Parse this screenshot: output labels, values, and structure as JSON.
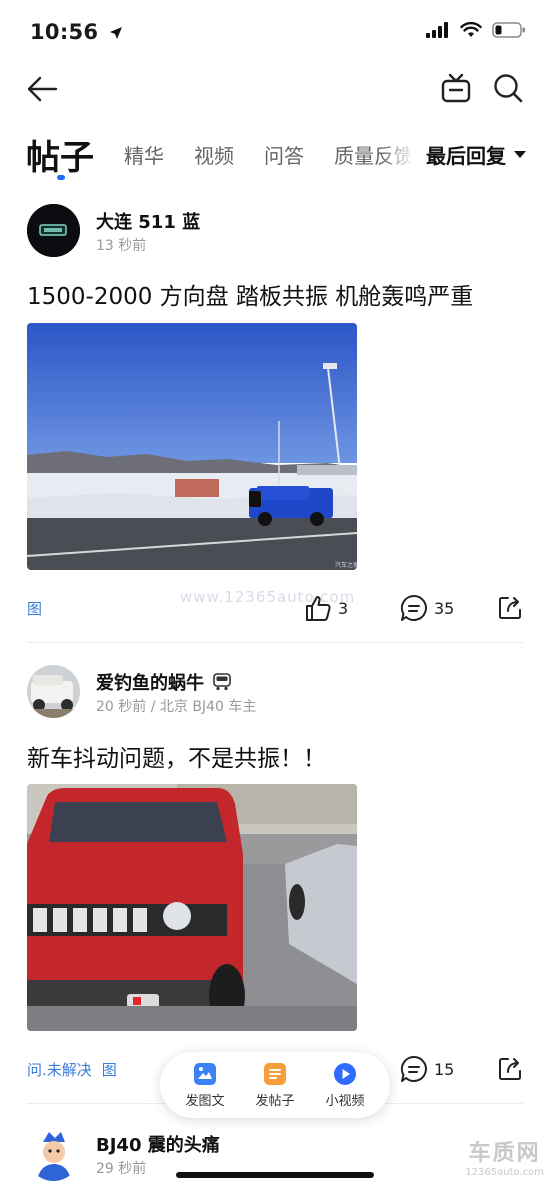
{
  "status_bar": {
    "time": "10:56"
  },
  "tabs": [
    {
      "label": "帖子",
      "active": true
    },
    {
      "label": "精华"
    },
    {
      "label": "视频"
    },
    {
      "label": "问答"
    },
    {
      "label": "质量反馈"
    }
  ],
  "sort": {
    "label": "最后回复"
  },
  "posts": [
    {
      "author": "大连 511 蓝",
      "meta": "13 秒前",
      "title": "1500-2000 方向盘 踏板共振 机舱轰鸣严重",
      "tags": [
        "图"
      ],
      "likes": "3",
      "comments": "35"
    },
    {
      "author": "爱钓鱼的蜗牛",
      "meta": "20 秒前 / 北京 BJ40 车主",
      "title": "新车抖动问题，不是共振！！",
      "tags": [
        "问.未解决",
        "图"
      ],
      "comments": "15"
    },
    {
      "author": "BJ40 震的头痛",
      "meta": "29 秒前"
    }
  ],
  "floating_bar": {
    "items": [
      {
        "label": "发图文",
        "color": "#3b82f6"
      },
      {
        "label": "发帖子",
        "color": "#f59e3b"
      },
      {
        "label": "小视频",
        "color": "#2f6bff"
      }
    ]
  },
  "watermark": "www.12365auto.com",
  "corner_logo": {
    "title": "车质网",
    "url": "12365auto.com"
  },
  "colors": {
    "accent": "#1f6bff",
    "tag": "#3a7bd5"
  }
}
